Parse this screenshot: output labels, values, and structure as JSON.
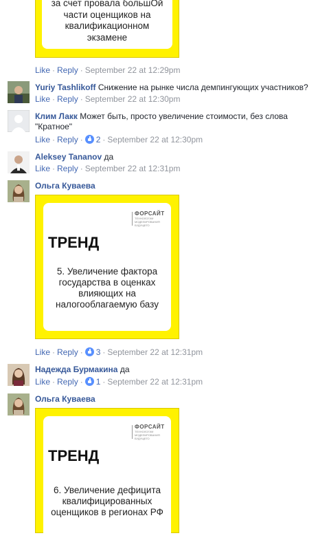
{
  "top_card": {
    "text_lines": [
      "за счет провала большОй",
      "части оценщиков на",
      "квалификационном",
      "экзамене"
    ]
  },
  "top_actions": {
    "like": "Like",
    "reply": "Reply",
    "time": "September 22 at 12:29pm"
  },
  "comments": [
    {
      "author": "Yuriy Tashlikoff",
      "text": "Снижение на рынке числа демпингующих участников?",
      "like": "Like",
      "reply": "Reply",
      "time": "September 22 at 12:30pm"
    },
    {
      "author": "Клим Лакк",
      "text_line1": "Может быть, просто увеличение стоимости, без слова",
      "text_line2": "\"Кратное\"",
      "like": "Like",
      "reply": "Reply",
      "reactions": "2",
      "time": "September 22 at 12:30pm"
    },
    {
      "author": "Aleksey Tananov",
      "text": "да",
      "like": "Like",
      "reply": "Reply",
      "time": "September 22 at 12:31pm"
    },
    {
      "author": "Ольга Куваева",
      "card": {
        "brand": "ФОРСАЙТ",
        "brand_sub": "ТЕХНОЛОГИИ МОДЕЛИРОВАНИЯ БУДУЩЕГО",
        "title": "ТРЕНД",
        "lines": [
          "5. Увеличение фактора",
          "государства в оценках",
          "влияющих на",
          "налогооблагаемую базу"
        ]
      },
      "like": "Like",
      "reply": "Reply",
      "reactions": "3",
      "time": "September 22 at 12:31pm"
    },
    {
      "author": "Надежда Бурмакина",
      "text": "да",
      "like": "Like",
      "reply": "Reply",
      "reactions": "1",
      "time": "September 22 at 12:31pm"
    },
    {
      "author": "Ольга Куваева",
      "card": {
        "brand": "ФОРСАЙТ",
        "brand_sub": "ТЕХНОЛОГИИ МОДЕЛИРОВАНИЯ БУДУЩЕГО",
        "title": "ТРЕНД",
        "lines": [
          "6. Увеличение дефицита",
          "квалифицированных",
          "оценщиков в регионах РФ"
        ]
      }
    }
  ]
}
